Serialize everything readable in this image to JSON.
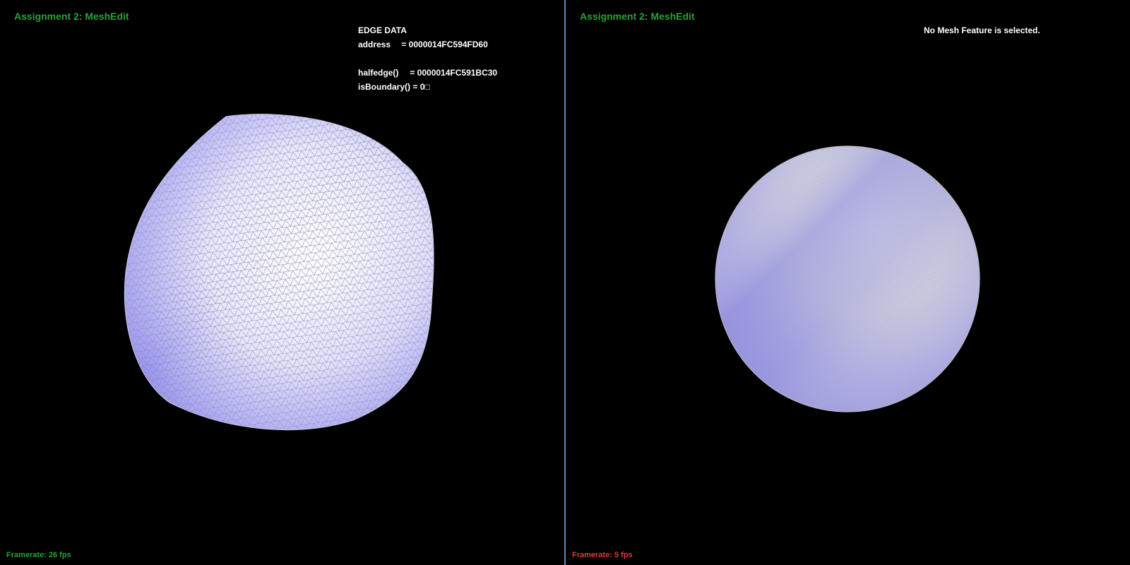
{
  "colors": {
    "background": "#000000",
    "title": "#26a331",
    "framerate_good": "#26a331",
    "framerate_bad": "#e23a3a",
    "info_text": "#ffffff",
    "mesh_light": "#ffffff",
    "mesh_shade": "#8a86f4",
    "wire": "#a8a8b4",
    "divider": "#5f86b6"
  },
  "left": {
    "title": "Assignment 2: MeshEdit",
    "info": {
      "header": "EDGE DATA",
      "address_key": "address",
      "address_val": "= 0000014FC594FD60",
      "halfedge_key": "halfedge()",
      "halfedge_val": "= 0000014FC591BC30",
      "boundary_key": "isBoundary()",
      "boundary_val": "= 0□"
    },
    "framerate_label": "Framerate:",
    "framerate_value": "26 fps",
    "mesh_icon": "subdivided-cube-mesh"
  },
  "right": {
    "title": "Assignment 2: MeshEdit",
    "status": "No Mesh Feature is selected.",
    "framerate_label": "Framerate:",
    "framerate_value": "5 fps",
    "mesh_icon": "dense-sphere-mesh"
  }
}
